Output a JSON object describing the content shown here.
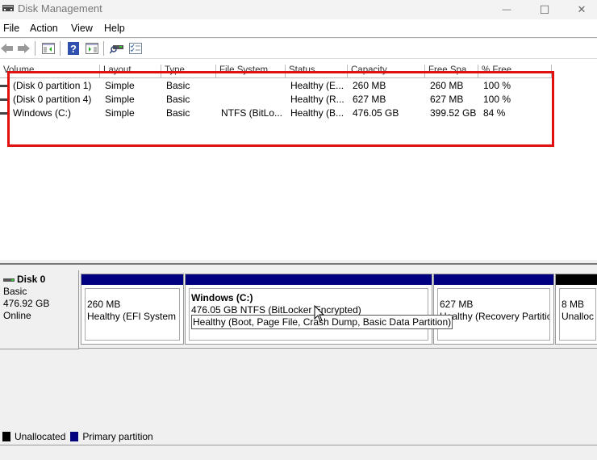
{
  "window": {
    "title": "Disk Management",
    "controls": {
      "minimize": "—",
      "maximize": "☐",
      "close": "✕"
    }
  },
  "menu": [
    "File",
    "Action",
    "View",
    "Help"
  ],
  "toolbar": {
    "buttons": [
      "back-icon",
      "forward-icon",
      "show-hide-console-tree-icon",
      "help-icon",
      "show-hide-action-pane-icon",
      "rescan-disks-icon",
      "properties-icon"
    ]
  },
  "volume_list": {
    "columns": [
      "Volume",
      "Layout",
      "Type",
      "File System",
      "Status",
      "Capacity",
      "Free Spa...",
      "% Free"
    ],
    "rows": [
      {
        "volume": "(Disk 0 partition 1)",
        "layout": "Simple",
        "type": "Basic",
        "file_system": "",
        "status": "Healthy (E...",
        "capacity": "260 MB",
        "free_space": "260 MB",
        "percent_free": "100 %"
      },
      {
        "volume": "(Disk 0 partition 4)",
        "layout": "Simple",
        "type": "Basic",
        "file_system": "",
        "status": "Healthy (R...",
        "capacity": "627 MB",
        "free_space": "627 MB",
        "percent_free": "100 %"
      },
      {
        "volume": "Windows (C:)",
        "layout": "Simple",
        "type": "Basic",
        "file_system": "NTFS (BitLo...",
        "status": "Healthy (B...",
        "capacity": "476.05 GB",
        "free_space": "399.52 GB",
        "percent_free": "84 %"
      }
    ]
  },
  "disk_map": {
    "disk": {
      "name": "Disk 0",
      "type": "Basic",
      "size": "476.92 GB",
      "status": "Online"
    },
    "partitions": [
      {
        "name": "",
        "line1": "260 MB",
        "line2": "Healthy (EFI System P",
        "kind": "primary"
      },
      {
        "name": "Windows  (C:)",
        "line1": "476.05 GB NTFS (BitLocker Encrypted)",
        "line2": "Healthy (Boot, Page File, Crash Dump, Basic Data Partition)",
        "kind": "primary"
      },
      {
        "name": "",
        "line1": "627 MB",
        "line2": "Healthy (Recovery Partitic",
        "kind": "primary"
      },
      {
        "name": "",
        "line1": "8 MB",
        "line2": "Unalloc",
        "kind": "unallocated"
      }
    ],
    "tooltip": "Healthy (Boot, Page File, Crash Dump, Basic Data Partition)"
  },
  "legend": [
    {
      "label": "Unallocated",
      "color": "#000000"
    },
    {
      "label": "Primary partition",
      "color": "#000080"
    }
  ],
  "colors": {
    "primary": "#000080",
    "unallocated": "#000000",
    "highlight": "#e01010"
  }
}
